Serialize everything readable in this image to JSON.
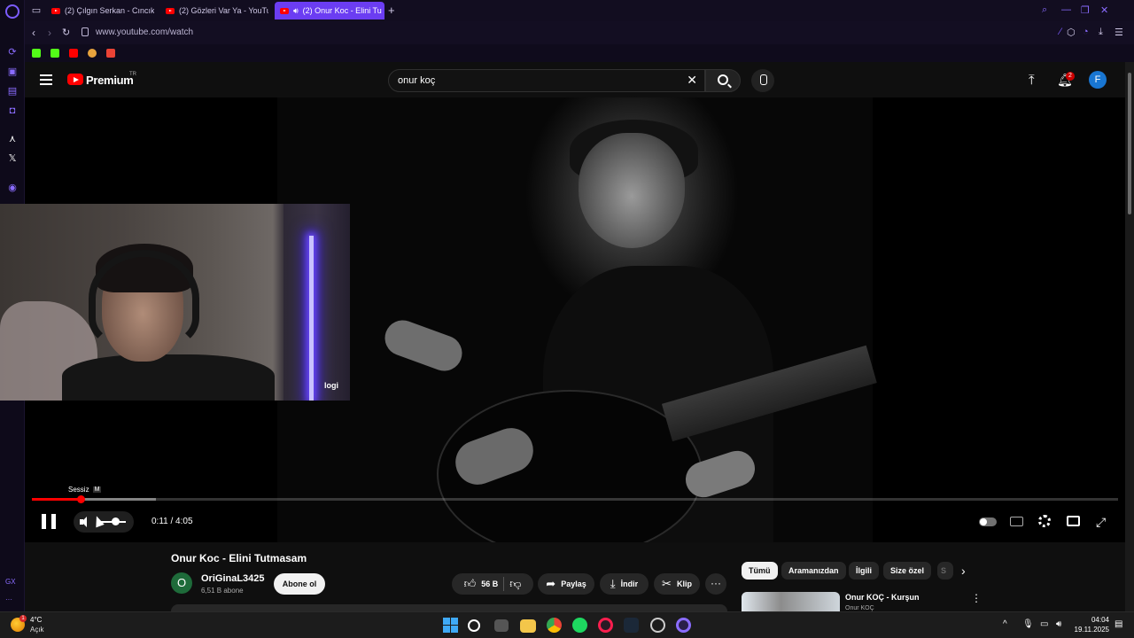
{
  "browser": {
    "tabs": [
      {
        "label": "(2) Çılgın Serkan - Cıncık",
        "active": false
      },
      {
        "label": "(2) Gözleri Var Ya - YouTu",
        "active": false
      },
      {
        "label": "(2) Onur Koc - Elini Tu",
        "active": true
      }
    ],
    "new_tab_glyph": "+",
    "url": "www.youtube.com/watch",
    "bookmark_icons": [
      "kick-icon",
      "kick-icon",
      "youtube-icon",
      "chess-icon",
      "gmail-icon"
    ]
  },
  "youtube": {
    "brand": "Premium",
    "region": "TR",
    "search_value": "onur koç",
    "notification_count": "2",
    "avatar_letter": "F",
    "accent": "#ff0000"
  },
  "player": {
    "tooltip_label": "Sessiz",
    "tooltip_key": "M",
    "time_current": "0:11",
    "time_total": "4:05",
    "time_display": "0:11 / 4:05",
    "progress_fraction": 0.045,
    "webcam_brand": "logi"
  },
  "video_info": {
    "title": "Onur Koc - Elini Tutmasam",
    "channel_initial": "O",
    "channel_name": "OriGinaL3425",
    "subscribers": "6,51 B abone",
    "subscribe_label": "Abone ol",
    "like_count": "56 B",
    "share_label": "Paylaş",
    "download_label": "İndir",
    "clip_label": "Klip"
  },
  "filters": [
    {
      "label": "Tümü",
      "active": true
    },
    {
      "label": "Aramanızdan",
      "active": false
    },
    {
      "label": "İlgili",
      "active": false
    },
    {
      "label": "Size özel",
      "active": false
    }
  ],
  "recommendation": {
    "title": "Onur KOÇ - Kurşun",
    "channel": "Onur KOÇ"
  },
  "taskbar": {
    "weather_temp": "4°C",
    "weather_status": "Açık",
    "weather_badge": "1",
    "time": "04:04",
    "date": "19.11.2025"
  },
  "sidebar": {
    "bottom_label": "GX"
  }
}
